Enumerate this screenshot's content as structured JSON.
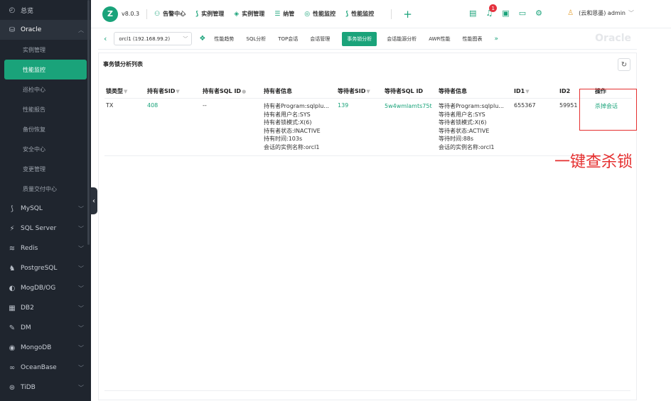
{
  "sidebar": {
    "overview": "总览",
    "oracle_header": "Oracle",
    "oracle_items": [
      "实例管理",
      "性能监控",
      "巡检中心",
      "性能报告",
      "备份恢复",
      "安全中心",
      "变更管理",
      "质量交付中心"
    ],
    "active_item": "性能监控",
    "db_items": [
      "MySQL",
      "SQL Server",
      "Redis",
      "PostgreSQL",
      "MogDB/OG",
      "DB2",
      "DM",
      "MongoDB",
      "OceanBase",
      "TiDB"
    ]
  },
  "topbar": {
    "logo": "Z",
    "version": "v8.0.3",
    "nav": [
      "告警中心",
      "实例管理",
      "实例管理",
      "纳管",
      "性能监控",
      "性能监控"
    ],
    "notification_count": "1",
    "user": "(云和恩墨) admin"
  },
  "tabbar": {
    "instance": "orcl1 (192.168.99.2)",
    "tabs": [
      "性能趋势",
      "SQL分析",
      "TOP会话",
      "会话管理",
      "事务锁分析",
      "会话能源分析",
      "AWR性能",
      "性能图表"
    ],
    "active_tab": "事务锁分析",
    "more": "»",
    "brand": "Oracle"
  },
  "card": {
    "title": "事务锁分析列表"
  },
  "table": {
    "columns": [
      "锁类型",
      "持有者SID",
      "持有者SQL ID",
      "持有者信息",
      "等待者SID",
      "等待者SQL ID",
      "等待者信息",
      "ID1",
      "ID2",
      "操作"
    ],
    "rows": [
      {
        "lock_type": "TX",
        "holder_sid": "408",
        "holder_sql_id": "--",
        "holder_info": [
          "持有者Program:sqlplu...",
          "持有者用户名:SYS",
          "持有者锁模式:X(6)",
          "持有者状态:INACTIVE",
          "持有时间:103s",
          "会话的实例名称:orcl1"
        ],
        "waiter_sid": "139",
        "waiter_sql_id": "5w4wmlamts75t",
        "waiter_info": [
          "等待者Program:sqlplu...",
          "等待者用户名:SYS",
          "等待者锁模式:X(6)",
          "等待者状态:ACTIVE",
          "等待时间:88s",
          "会话的实例名称:orcl1"
        ],
        "id1": "655367",
        "id2": "59951",
        "action": "杀掉会话"
      }
    ]
  },
  "annotation": {
    "text": "一键查杀锁",
    "color": "#e52f2f"
  },
  "colors": {
    "accent": "#1aa37a",
    "sidebar_bg": "#1f252e",
    "badge": "#e5323e"
  }
}
